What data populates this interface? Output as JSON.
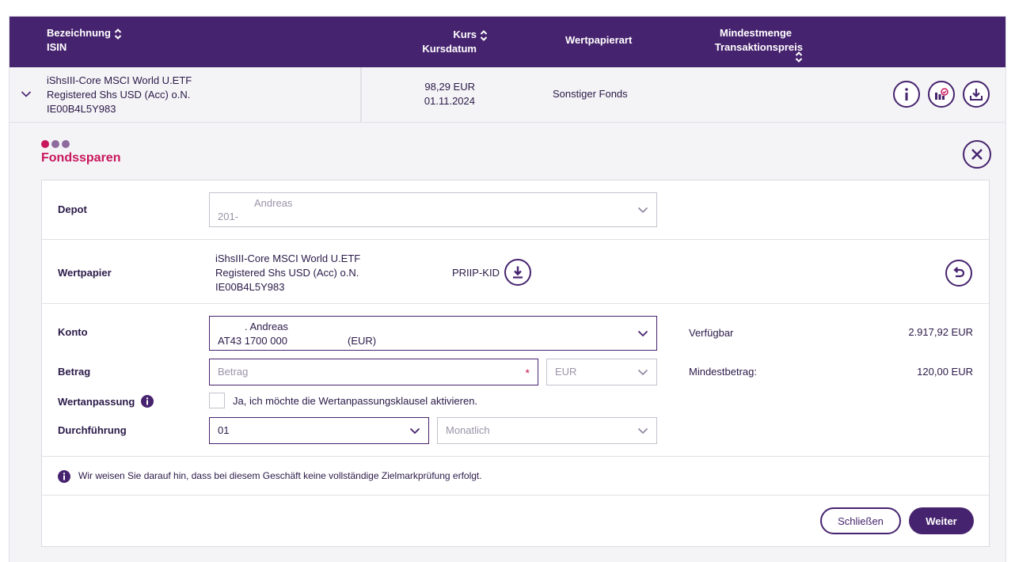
{
  "table": {
    "headers": {
      "name_line1": "Bezeichnung",
      "name_line2": "ISIN",
      "price_line1": "Kurs",
      "price_line2": "Kursdatum",
      "type": "Wertpapierart",
      "min_line1": "Mindestmenge",
      "min_line2": "Transaktionspreis"
    },
    "row": {
      "name_line1": "iShsIII-Core MSCI World U.ETF",
      "name_line2": "Registered Shs USD (Acc) o.N.",
      "isin": "IE00B4L5Y983",
      "price": "98,29 EUR",
      "date": "01.11.2024",
      "type": "Sonstiger Fonds"
    }
  },
  "panel": {
    "title": "Fondssparen",
    "depot": {
      "label": "Depot",
      "value_line1": "Andreas",
      "value_line2": "201-"
    },
    "wertpapier": {
      "label": "Wertpapier",
      "name_line1": "iShsIII-Core MSCI World U.ETF",
      "name_line2": "Registered Shs USD (Acc) o.N.",
      "isin": "IE00B4L5Y983",
      "kid_label": "PRIIP-KID"
    },
    "konto": {
      "label": "Konto",
      "value_line1": ". Andreas",
      "value_line2": "AT43 1700 000",
      "currency": "(EUR)",
      "available_label": "Verfügbar",
      "available_value": "2.917,92 EUR"
    },
    "betrag": {
      "label": "Betrag",
      "placeholder": "Betrag",
      "required_mark": "*",
      "currency": "EUR",
      "min_label": "Mindestbetrag:",
      "min_value": "120,00 EUR"
    },
    "wertanpassung": {
      "label": "Wertanpassung",
      "checkbox_label": "Ja, ich möchte die Wertanpassungsklausel aktivieren."
    },
    "durchfuehrung": {
      "label": "Durchführung",
      "day_value": "01",
      "interval_value": "Monatlich"
    },
    "notice": "Wir weisen Sie darauf hin, dass bei diesem Geschäft keine vollständige Zielmarkprüfung erfolgt.",
    "close_label": "Schließen",
    "next_label": "Weiter"
  },
  "colors": {
    "primary": "#46236e",
    "accent": "#c8175c",
    "background": "#f4f3f6"
  }
}
